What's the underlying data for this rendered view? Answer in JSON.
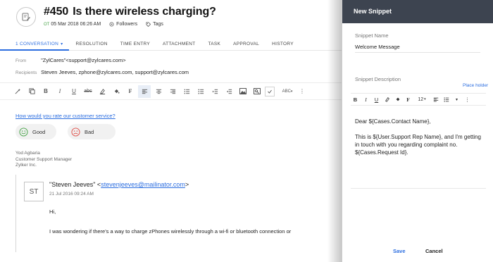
{
  "ticket": {
    "number": "#450",
    "subject": "Is there wireless charging?",
    "due_label": "OT",
    "date": "05 Mar 2018 06:26 AM",
    "followers_label": "Followers",
    "tags_label": "Tags",
    "icon": "ticket-edit-icon"
  },
  "tabs": [
    {
      "label": "1 CONVERSATION",
      "active": true
    },
    {
      "label": "RESOLUTION"
    },
    {
      "label": "TIME ENTRY"
    },
    {
      "label": "ATTACHMENT"
    },
    {
      "label": "TASK"
    },
    {
      "label": "APPROVAL"
    },
    {
      "label": "HISTORY"
    }
  ],
  "reply": {
    "from_label": "From",
    "from_value": "\"ZylCares\"<support@zylcares.com>",
    "recipients_label": "Recipients",
    "recipients_value": "Steven Jeeves, zphone@zylcares.com, support@zylcares.com"
  },
  "toolbar_icons": [
    "magic-icon",
    "copy-icon",
    "bold-icon",
    "italic-icon",
    "underline-icon",
    "strikethrough-icon",
    "text-color-icon",
    "highlight-icon",
    "font-icon",
    "align-left-icon",
    "align-center-icon",
    "align-right-icon",
    "ordered-list-icon",
    "unordered-list-icon",
    "indent-icon",
    "outdent-icon",
    "insert-image-icon",
    "insert-link-icon",
    "spellcheck-icon",
    "more-icon"
  ],
  "survey": {
    "question": "How would you rate our customer service?",
    "good_label": "Good",
    "bad_label": "Bad"
  },
  "signature": {
    "name": "Yod Agbaria",
    "role": "Customer Support Manager",
    "company": "Zylker Inc."
  },
  "quoted": {
    "avatar_initials": "ST",
    "from_name": "\"Steven Jeeves\" <",
    "from_email": "stevenjeeves@mailinator.com",
    "from_end": ">",
    "date": "21 Jul 2016 09:24 AM",
    "greeting": "Hi,",
    "body": "I was wondering if there's a way to charge zPhones wirelessly through a wi-fi or bluetooth connection or"
  },
  "snippet": {
    "title": "New Snippet",
    "name_label": "Snippet Name",
    "name_value": "Welcome Message",
    "description_label": "Snippet Description",
    "placeholder_link": "Place holder",
    "font_size": "12",
    "body_line1": "Dear ${Cases.Contact Name},",
    "body_line2": "This is ${User.Support Rep Name}, and I'm getting in touch with you regarding complaint no. ${Cases.Request Id}.",
    "save_label": "Save",
    "cancel_label": "Cancel"
  },
  "colors": {
    "accent": "#2c6ee0",
    "header_dark": "#3d4450",
    "good": "#49a44a",
    "bad": "#e0514b"
  }
}
